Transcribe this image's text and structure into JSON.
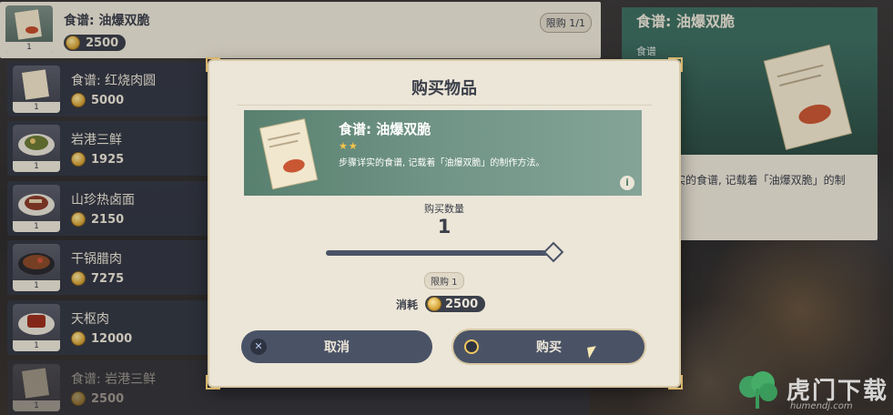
{
  "shop": {
    "items": [
      {
        "name": "食谱: 油爆双脆",
        "price": "2500",
        "qty": "1",
        "limit": "限购 1/1",
        "selected": true
      },
      {
        "name": "食谱: 红烧肉圆",
        "price": "5000",
        "qty": "1"
      },
      {
        "name": "岩港三鲜",
        "price": "1925",
        "qty": "1"
      },
      {
        "name": "山珍热卤面",
        "price": "2150",
        "qty": "1"
      },
      {
        "name": "干锅腊肉",
        "price": "7275",
        "qty": "1"
      },
      {
        "name": "天枢肉",
        "price": "12000",
        "qty": "1"
      },
      {
        "name": "食谱: 岩港三鲜",
        "price": "2500",
        "qty": "1"
      }
    ]
  },
  "detail": {
    "title": "食谱: 油爆双脆",
    "type": "食谱",
    "desc_line1": "实的食谱, 记载着「油爆双脆」的制",
    "desc_line2": "。"
  },
  "modal": {
    "title": "购买物品",
    "item_name": "食谱: 油爆双脆",
    "stars": "★★",
    "item_desc": "步骤详实的食谱, 记载着「油爆双脆」的制作方法。",
    "info_icon": "i",
    "qty_label": "购买数量",
    "qty_value": "1",
    "slider_fraction": 1.0,
    "limit": "限购 1",
    "cost_label": "消耗",
    "cost_value": "2500",
    "cancel_label": "取消",
    "buy_label": "购买"
  },
  "watermark": {
    "text": "虎门下载",
    "url": "humendj.com"
  },
  "colors": {
    "panel": "#ece6d8",
    "dark": "#3b3f4a",
    "teal": "#3f6f62",
    "gold": "#d8b46a"
  }
}
